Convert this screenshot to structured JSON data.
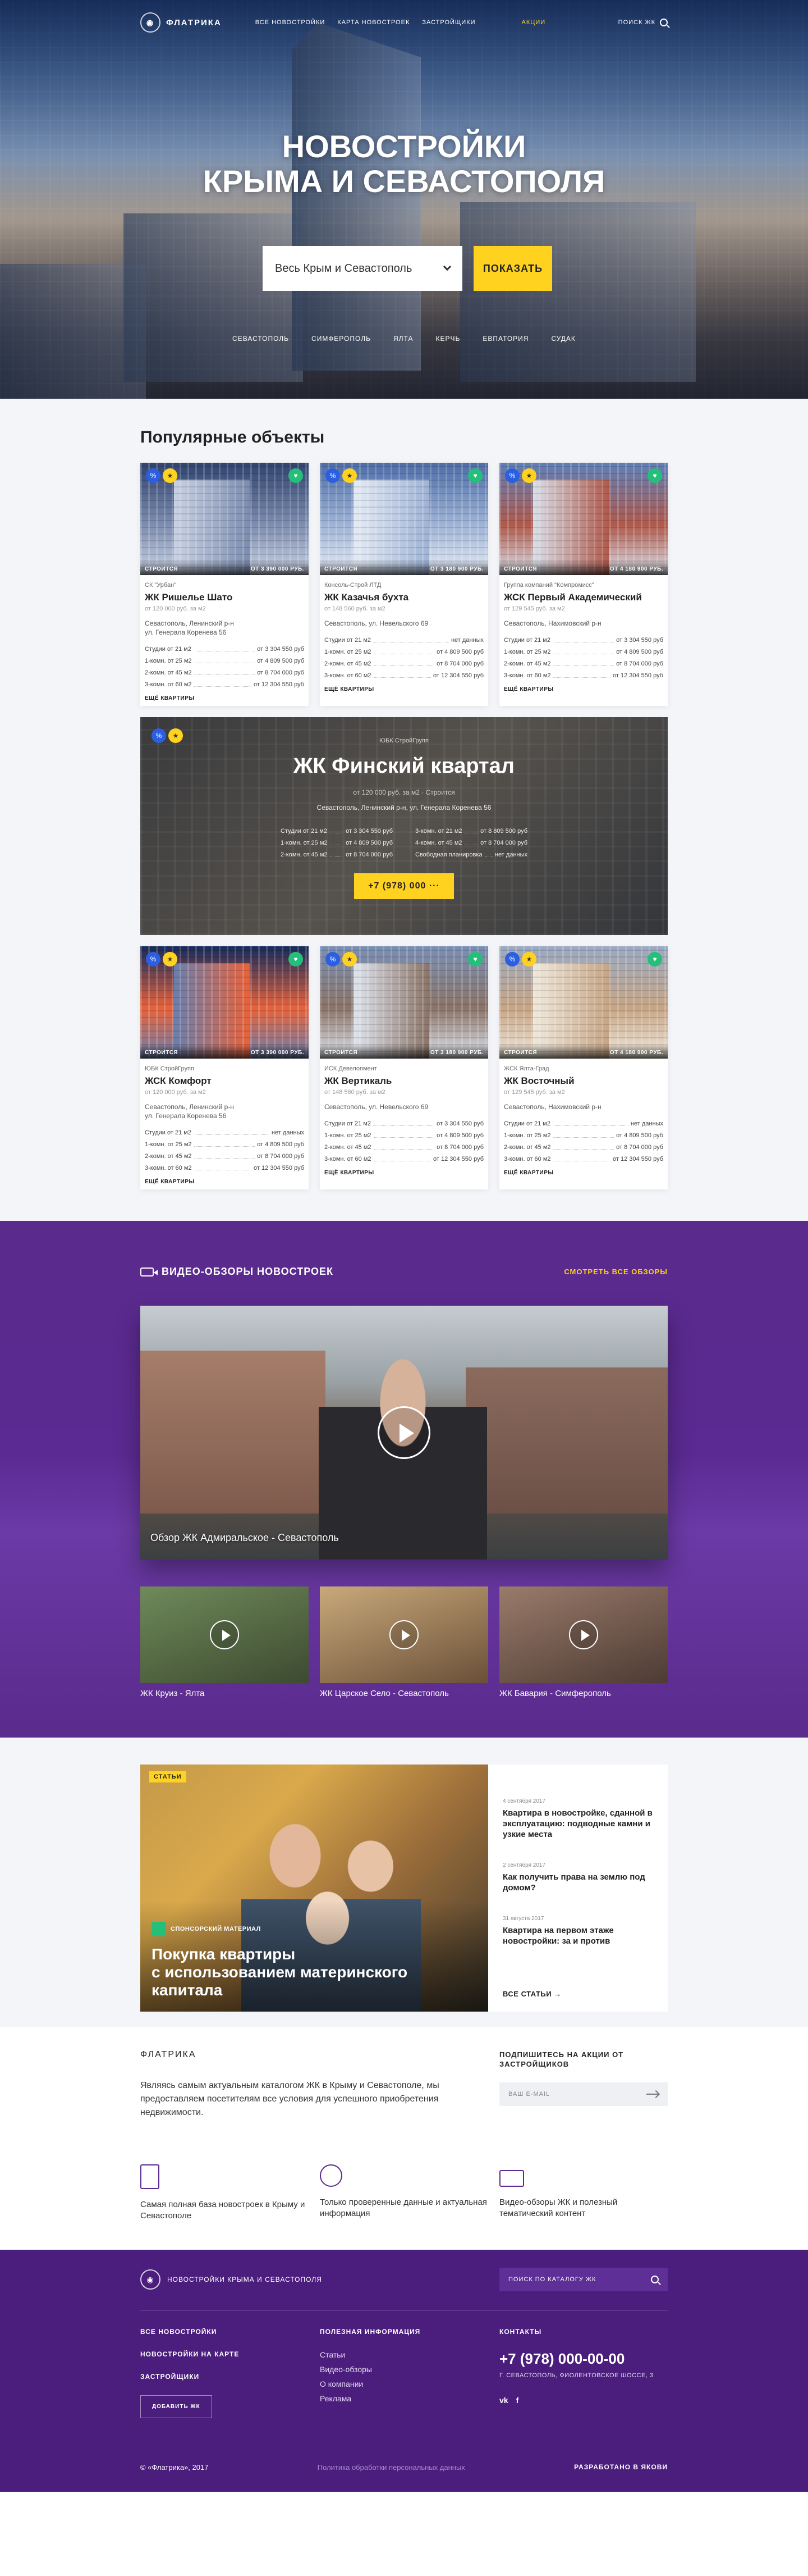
{
  "header": {
    "logo": "ФЛАТРИКА",
    "nav": [
      "ВСЕ НОВОСТРОЙКИ",
      "КАРТА НОВОСТРОЕК",
      "ЗАСТРОЙЩИКИ"
    ],
    "nav_hot": "АКЦИИ",
    "search": "ПОИСК ЖК"
  },
  "hero": {
    "title": "НОВОСТРОЙКИ\nКРЫМА И СЕВАСТОПОЛЯ",
    "select_value": "Весь Крым и Севастополь",
    "show_button": "ПОКАЗАТЬ",
    "cities": [
      "СЕВАСТОПОЛЬ",
      "СИМФЕРОПОЛЬ",
      "ЯЛТА",
      "КЕРЧЬ",
      "ЕВПАТОРИЯ",
      "СУДАК"
    ]
  },
  "popular": {
    "title": "Популярные объекты",
    "more_label": "ЕЩЁ КВАРТИРЫ",
    "cards_top": [
      {
        "status": "СТРОИТСЯ",
        "price_from": "ОТ 3 390 000 РУБ.",
        "dev": "СК \"Урбан\"",
        "name": "ЖК Ришелье Шато",
        "ppm": "от 120 000 руб. за м2",
        "addr": "Севастополь, Ленинский р-н\nул. Генерала Коренева 56",
        "apts": [
          [
            "Студии от 21 м2",
            "от 3 304 550 руб"
          ],
          [
            "1-комн. от 25 м2",
            "от 4 809 500 руб"
          ],
          [
            "2-комн. от 45 м2",
            "от 8 704 000 руб"
          ],
          [
            "3-комн. от 60 м2",
            "от 12 304 550 руб"
          ]
        ],
        "colors": [
          "#30436e",
          "#7d8db0",
          "#c9d2e4"
        ]
      },
      {
        "status": "СТРОИТСЯ",
        "price_from": "ОТ 3 180 900 РУБ.",
        "dev": "Консоль-Строй ЛТД",
        "name": "ЖК Казачья бухта",
        "ppm": "от 148 560 руб. за м2",
        "addr": "Севастополь, ул. Невельского 69",
        "apts": [
          [
            "Студии от 21 м2",
            "нет данных"
          ],
          [
            "1-комн. от 25 м2",
            "от 4 809 500 руб"
          ],
          [
            "2-комн. от 45 м2",
            "от 8 704 000 руб"
          ],
          [
            "3-комн. от 60 м2",
            "от 12 304 550 руб"
          ]
        ],
        "colors": [
          "#4d6da8",
          "#9fb3d6",
          "#e4ebf5"
        ]
      },
      {
        "status": "СТРОИТСЯ",
        "price_from": "ОТ 4 180 900 РУБ.",
        "dev": "Группа компаний \"Компромисс\"",
        "name": "ЖСК Первый Академический",
        "ppm": "от 129 545 руб. за м2",
        "addr": "Севастополь, Нахимовский р-н",
        "apts": [
          [
            "Студии от 21 м2",
            "от 3 304 550 руб"
          ],
          [
            "1-комн. от 25 м2",
            "от 4 809 500 руб"
          ],
          [
            "2-комн. от 45 м2",
            "от 8 704 000 руб"
          ],
          [
            "3-комн. от 60 м2",
            "от 12 304 550 руб"
          ]
        ],
        "colors": [
          "#5e7fb8",
          "#b05a4c",
          "#d9dfe9"
        ]
      }
    ],
    "featured": {
      "dev": "ЮБК СтройГрупп",
      "name": "ЖК Финский квартал",
      "ppm": "от 120 000 руб. за м2 · Строится",
      "addr": "Севастополь, Ленинский р-н, ул. Генерала Коренева 56",
      "apts": [
        [
          "Студии от 21 м2",
          "от 3 304 550 руб"
        ],
        [
          "3-комн. от 21 м2",
          "от 8 809 500 руб"
        ],
        [
          "1-комн. от 25 м2",
          "от 4 809 500 руб"
        ],
        [
          "4-комн. от 45 м2",
          "от 8 704 000 руб"
        ],
        [
          "2-комн. от 45 м2",
          "от 8 704 000 руб"
        ],
        [
          "Свободная планировка",
          "нет данных"
        ]
      ],
      "phone": "+7 (978) 000 ···"
    },
    "cards_bottom": [
      {
        "status": "СТРОИТСЯ",
        "price_from": "ОТ 3 390 000 РУБ.",
        "dev": "ЮБК СтройГрупп",
        "name": "ЖСК Комфорт",
        "ppm": "от 120 000 руб. за м2",
        "addr": "Севастополь, Ленинский р-н\nул. Генерала Коренева 56",
        "apts": [
          [
            "Студии от 21 м2",
            "нет данных"
          ],
          [
            "1-комн. от 25 м2",
            "от 4 809 500 руб"
          ],
          [
            "2-комн. от 45 м2",
            "от 8 704 000 руб"
          ],
          [
            "3-комн. от 60 м2",
            "от 12 304 550 руб"
          ]
        ],
        "colors": [
          "#152a5c",
          "#e8623a",
          "#6a7fae"
        ]
      },
      {
        "status": "СТРОИТСЯ",
        "price_from": "ОТ 3 180 900 РУБ.",
        "dev": "ИСК Девелопмент",
        "name": "ЖК Вертикаль",
        "ppm": "от 148 560 руб. за м2",
        "addr": "Севастополь, ул. Невельского 69",
        "apts": [
          [
            "Студии от 21 м2",
            "от 3 304 550 руб"
          ],
          [
            "1-комн. от 25 м2",
            "от 4 809 500 руб"
          ],
          [
            "2-комн. от 45 м2",
            "от 8 704 000 руб"
          ],
          [
            "3-комн. от 60 м2",
            "от 12 304 550 руб"
          ]
        ],
        "colors": [
          "#7a8fb5",
          "#8b7468",
          "#dfe5ee"
        ]
      },
      {
        "status": "СТРОИТСЯ",
        "price_from": "ОТ 4 180 900 РУБ.",
        "dev": "ЖСК Ялта-Град",
        "name": "ЖК Восточный",
        "ppm": "от 129 545 руб. за м2",
        "addr": "Севастополь, Нахимовский р-н",
        "apts": [
          [
            "Студии от 21 м2",
            "нет данных"
          ],
          [
            "1-комн. от 25 м2",
            "от 4 809 500 руб"
          ],
          [
            "2-комн. от 45 м2",
            "от 8 704 000 руб"
          ],
          [
            "3-комн. от 60 м2",
            "от 12 304 550 руб"
          ]
        ],
        "colors": [
          "#9aa9c3",
          "#c7a585",
          "#efe8dc"
        ]
      }
    ]
  },
  "video": {
    "title": "ВИДЕО-ОБЗОРЫ НОВОСТРОЕК",
    "all": "СМОТРЕТЬ ВСЕ ОБЗОРЫ",
    "main_caption": "Обзор ЖК Адмиральское - Севастополь",
    "thumbs": [
      {
        "caption": "ЖК Круиз - Ялта",
        "colors": [
          "#6f8a5a",
          "#3d4a30"
        ]
      },
      {
        "caption": "ЖК Царское Село - Севастополь",
        "colors": [
          "#c9a97a",
          "#6a5038"
        ]
      },
      {
        "caption": "ЖК Бавария - Симферополь",
        "colors": [
          "#9a7b6a",
          "#4d3b34"
        ]
      }
    ]
  },
  "articles": {
    "tag": "СТАТЬИ",
    "sponsor": "СПОНСОРСКИЙ МАТЕРИАЛ",
    "main_title": "Покупка квартиры\nс использованием материнского\nкапитала",
    "items": [
      {
        "date": "4 сентября 2017",
        "title": "Квартира в новостройке, сданной в эксплуатацию: подводные камни и узкие места"
      },
      {
        "date": "2 сентября 2017",
        "title": "Как получить права на землю под домом?"
      },
      {
        "date": "31 августа 2017",
        "title": "Квартира на первом этаже новостройки: за и против"
      }
    ],
    "all": "ВСЕ СТАТЬИ →"
  },
  "about": {
    "title": "ФЛАТРИКА",
    "text": "Являясь самым актуальным каталогом ЖК в Крыму и Севастополе, мы предоставляем посетителям все условия для успешного приобретения недвижимости.",
    "subscribe_title": "ПОДПИШИТЕСЬ НА АКЦИИ ОТ ЗАСТРОЙЩИКОВ",
    "email_placeholder": "ВАШ E-MAIL",
    "features": [
      "Самая полная база новостроек в Крыму и Севастополе",
      "Только проверенные данные и актуальная информация",
      "Видео-обзоры ЖК и полезный тематический контент"
    ]
  },
  "footer": {
    "logo": "НОВОСТРОЙКИ КРЫМА И СЕВАСТОПОЛЯ",
    "search": "ПОИСК ПО КАТАЛОГУ ЖК",
    "col1": [
      "ВСЕ НОВОСТРОЙКИ",
      "НОВОСТРОЙКИ НА КАРТЕ",
      "ЗАСТРОЙЩИКИ"
    ],
    "add_button": "ДОБАВИТЬ ЖК",
    "col2_title": "ПОЛЕЗНАЯ ИНФОРМАЦИЯ",
    "col2": [
      "Статьи",
      "Видео-обзоры",
      "О компании",
      "Реклама"
    ],
    "col3_title": "КОНТАКТЫ",
    "phone": "+7 (978) 000-00-00",
    "address": "Г. СЕВАСТОПОЛЬ, ФИОЛЕНТОВСКОЕ ШОССЕ, 3",
    "social_vk": "vk",
    "social_fb": "f",
    "copyright": "© «Флатрика», 2017",
    "policy": "Политика обработки персональных данных",
    "developer": "РАЗРАБОТАНО В ЯКОВИ"
  }
}
